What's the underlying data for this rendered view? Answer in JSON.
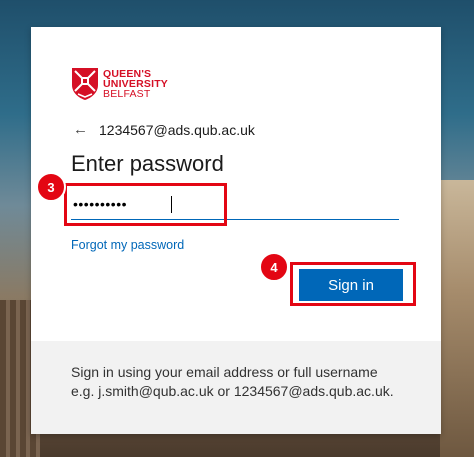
{
  "brand": {
    "line1": "QUEEN'S",
    "line2": "UNIVERSITY",
    "line3": "BELFAST",
    "color": "#d50f25"
  },
  "identity": {
    "back_icon": "arrow-left-icon",
    "email": "1234567@ads.qub.ac.uk"
  },
  "page_title": "Enter password",
  "password_field": {
    "value": "••••••••••",
    "masked": true
  },
  "forgot_link": "Forgot my password",
  "sign_in_button": "Sign in",
  "footer": {
    "line1": "Sign in using your email address or full username",
    "line2": "e.g. j.smith@qub.ac.uk or 1234567@ads.qub.ac.uk."
  },
  "annotations": {
    "step3": "3",
    "step4": "4",
    "highlight_color": "#e30613"
  },
  "accent_color": "#0067b8"
}
